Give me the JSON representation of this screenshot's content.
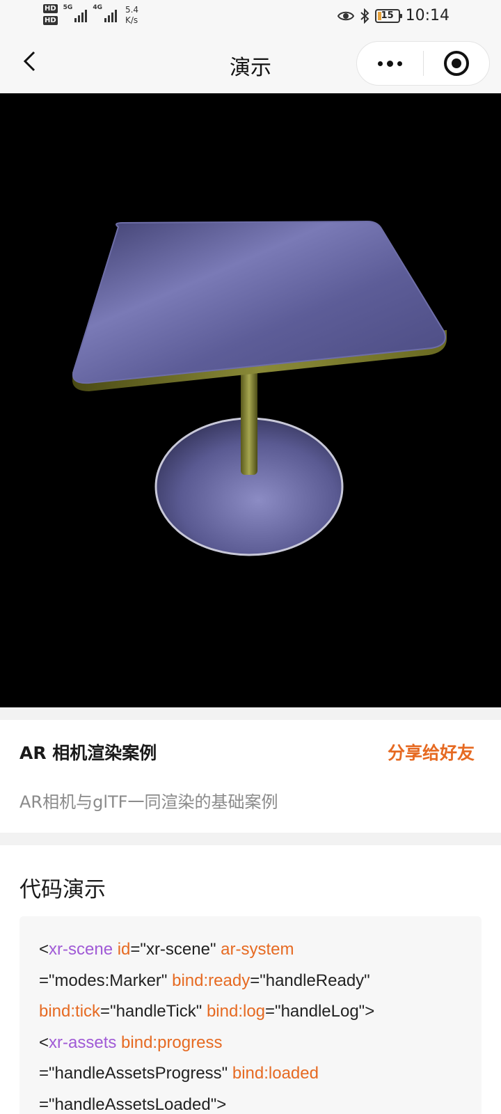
{
  "status_bar": {
    "hd_1": "HD",
    "hd_2": "HD",
    "sim1_label": "5G",
    "sim2_label": "4G",
    "speed_value": "5.4",
    "speed_unit": "K/s",
    "battery": "15",
    "time": "10:14",
    "icons": [
      "eye-icon",
      "bluetooth-icon",
      "battery-icon"
    ]
  },
  "nav": {
    "title": "演示",
    "icons": [
      "back-chevron-icon",
      "more-dots-icon",
      "close-target-icon"
    ]
  },
  "case": {
    "title": "AR 相机渲染案例",
    "share": "分享给好友",
    "description": "AR相机与glTF一同渲染的基础案例"
  },
  "code": {
    "heading": "代码演示",
    "lines": [
      [
        {
          "t": "<",
          "c": "p"
        },
        {
          "t": "xr-scene",
          "c": "tag"
        },
        {
          "t": " ",
          "c": "p"
        },
        {
          "t": "id",
          "c": "attr"
        },
        {
          "t": "=\"xr-scene\" ",
          "c": "p"
        },
        {
          "t": "ar-system",
          "c": "attr"
        }
      ],
      [
        {
          "t": "=\"modes:Marker\" ",
          "c": "p"
        },
        {
          "t": "bind:ready",
          "c": "attr"
        },
        {
          "t": "=\"handleReady\"",
          "c": "p"
        }
      ],
      [
        {
          "t": "bind:tick",
          "c": "attr"
        },
        {
          "t": "=\"handleTick\" ",
          "c": "p"
        },
        {
          "t": "bind:log",
          "c": "attr"
        },
        {
          "t": "=\"handleLog\">",
          "c": "p"
        }
      ],
      [
        {
          "t": "<",
          "c": "p"
        },
        {
          "t": "xr-assets",
          "c": "tag"
        },
        {
          "t": " ",
          "c": "p"
        },
        {
          "t": "bind:progress",
          "c": "attr"
        }
      ],
      [
        {
          "t": "=\"handleAssetsProgress\" ",
          "c": "p"
        },
        {
          "t": "bind:loaded",
          "c": "attr"
        }
      ],
      [
        {
          "t": "=\"handleAssetsLoaded\">",
          "c": "p"
        }
      ]
    ]
  },
  "colors": {
    "accent": "#e66a22",
    "code_tag": "#a05ad6",
    "code_attr": "#e66a22",
    "viewport_bg": "#000000"
  }
}
